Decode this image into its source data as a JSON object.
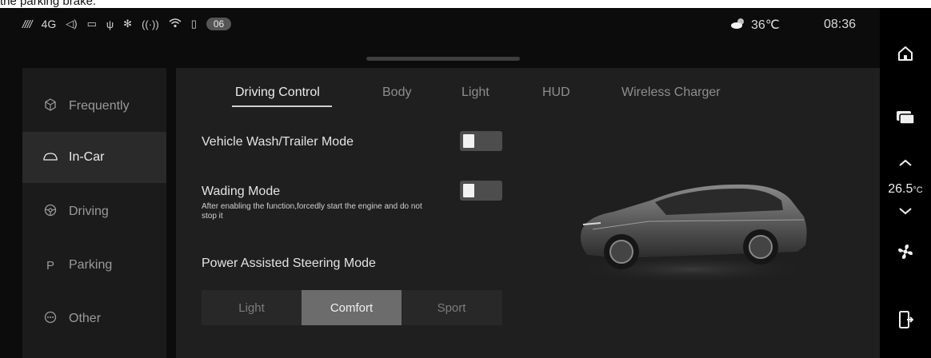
{
  "caption": "the parking brake.",
  "status": {
    "signal": "////",
    "network": "4G",
    "badge": "06",
    "weather": "36℃",
    "time": "08:36"
  },
  "sidebar": {
    "items": [
      {
        "label": "Frequently",
        "icon": "cube-icon"
      },
      {
        "label": "In-Car",
        "icon": "car-icon"
      },
      {
        "label": "Driving",
        "icon": "steering-wheel-icon"
      },
      {
        "label": "Parking",
        "icon": "parking-icon"
      },
      {
        "label": "Other",
        "icon": "more-icon"
      }
    ],
    "active": "In-Car"
  },
  "tabs": [
    "Driving Control",
    "Body",
    "Light",
    "HUD",
    "Wireless Charger"
  ],
  "active_tab": "Driving Control",
  "settings": {
    "wash_label": "Vehicle Wash/Trailer Mode",
    "wash_on": false,
    "wading_label": "Wading Mode",
    "wading_desc": "After enabling the function,forcedly start the engine and do not stop it",
    "wading_on": false,
    "steering_label": "Power Assisted Steering Mode",
    "steering_options": [
      "Light",
      "Comfort",
      "Sport"
    ],
    "steering_selected": "Comfort"
  },
  "climate": {
    "temp": "26.5",
    "unit": "°C"
  },
  "colors": {
    "background": "#0c0c0c",
    "panel": "#1f1f1f",
    "sidebar": "#1b1b1b",
    "selected_segment": "#6c6c6c"
  }
}
